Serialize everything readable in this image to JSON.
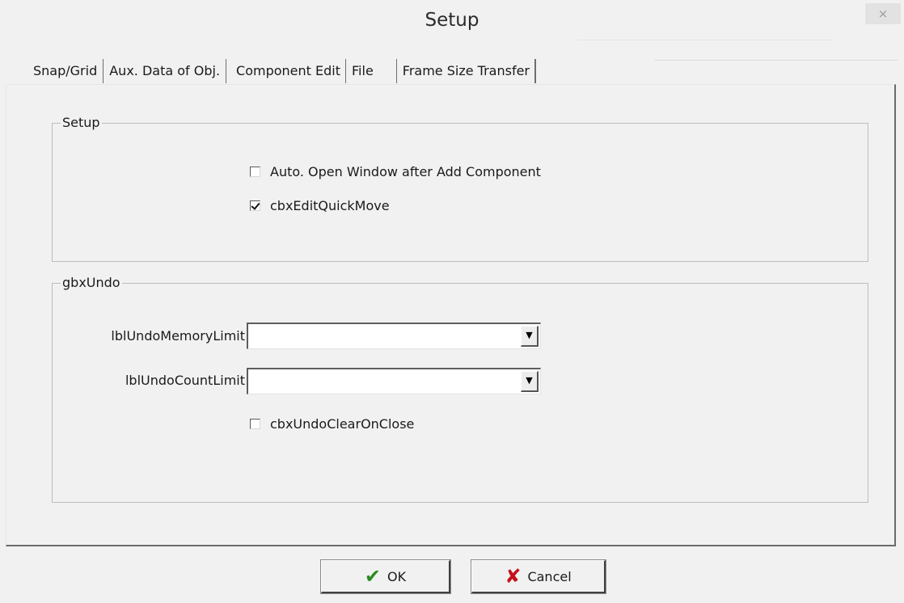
{
  "window": {
    "title": "Setup",
    "close_label": "×"
  },
  "tabs": [
    {
      "label": "Snap/Grid"
    },
    {
      "label": "Aux. Data of Obj."
    },
    {
      "label": "Component Edit"
    },
    {
      "label": "File"
    },
    {
      "label": "Frame Size Transfer"
    }
  ],
  "active_tab": "Component Edit",
  "setup_group": {
    "legend": "Setup",
    "auto_open": {
      "label": "Auto. Open Window after Add Component",
      "checked": false
    },
    "quick_move": {
      "label": "cbxEditQuickMove",
      "checked": true
    }
  },
  "undo_group": {
    "legend": "gbxUndo",
    "memory_limit": {
      "label": "lblUndoMemoryLimit",
      "value": ""
    },
    "count_limit": {
      "label": "lblUndoCountLimit",
      "value": ""
    },
    "clear_on_close": {
      "label": "cbxUndoClearOnClose",
      "checked": false
    }
  },
  "buttons": {
    "ok_label": "OK",
    "ok_icon": "check-icon",
    "cancel_label": "Cancel",
    "cancel_icon": "x-icon"
  },
  "icons": {
    "check_glyph": "✔",
    "x_glyph": "✘",
    "dropdown_glyph": "▼"
  },
  "colors": {
    "ok_icon": "#2a8a1f",
    "cancel_icon": "#c4121b"
  }
}
